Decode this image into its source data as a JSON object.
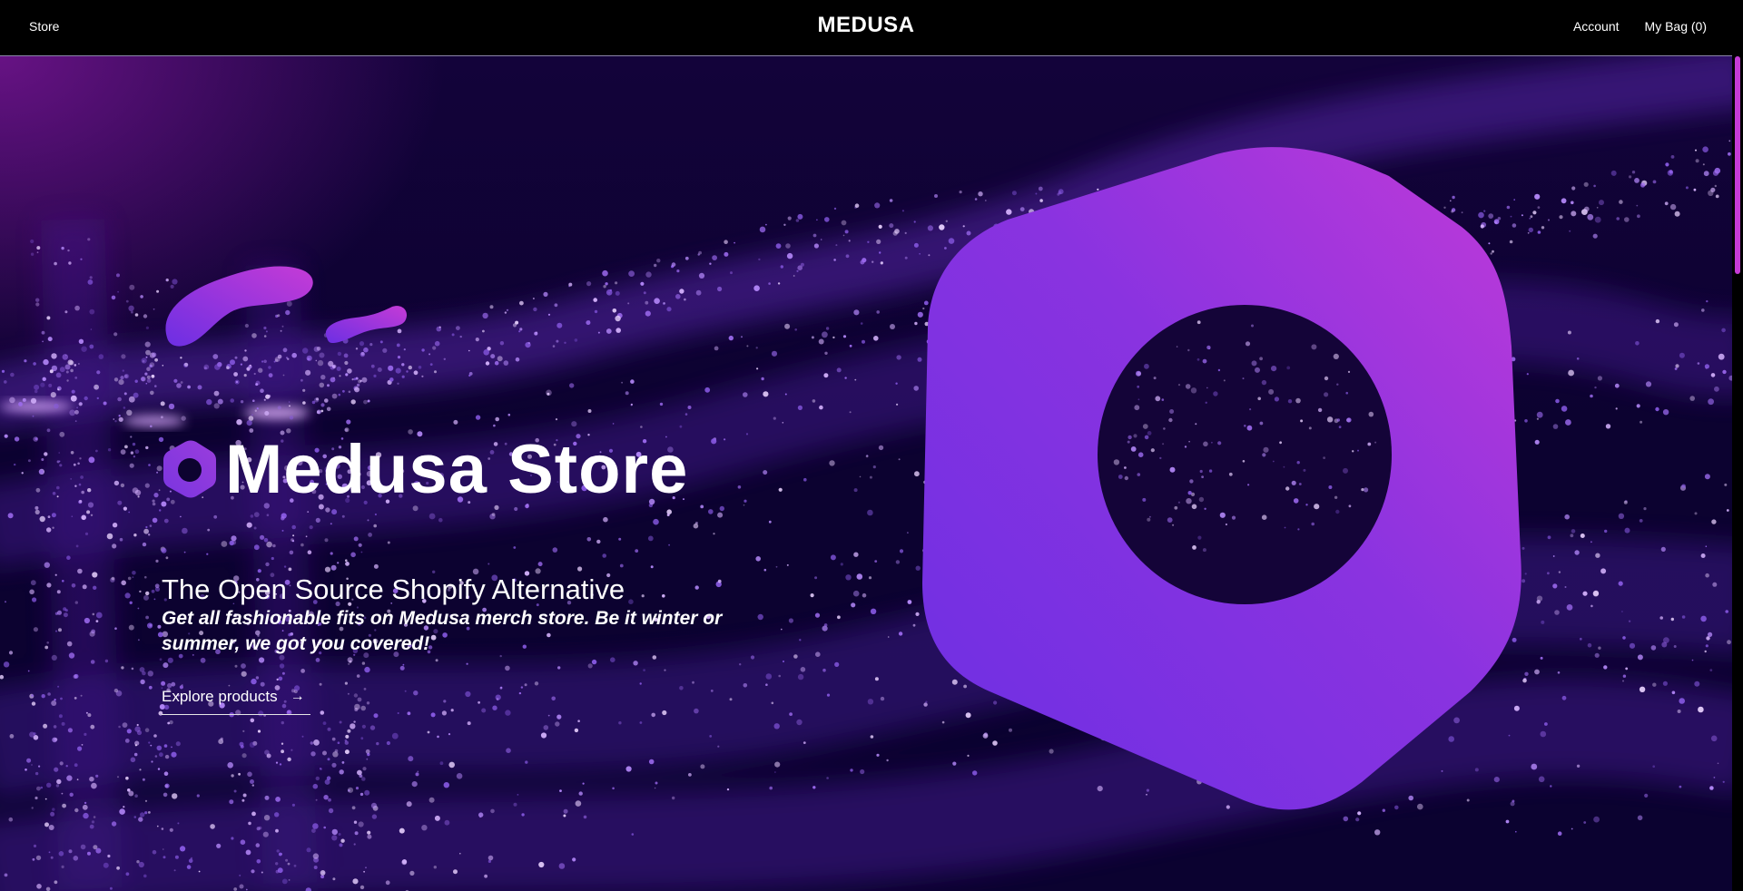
{
  "header": {
    "store_link": "Store",
    "brand": "MEDUSA",
    "account_link": "Account",
    "bag_link": "My Bag (0)"
  },
  "hero": {
    "title": "Medusa Store",
    "subtitle": "The Open Source Shopify Alternative",
    "description": "Get all fashionable fits on Medusa merch store. Be it winter or summer, we got you covered!",
    "cta_label": "Explore products",
    "cta_icon": "arrow-right-icon"
  },
  "colors": {
    "accent_purple": "#7b2fe0",
    "accent_magenta": "#c53bd6",
    "background_dark": "#0b0230",
    "header_bg": "#000000"
  }
}
